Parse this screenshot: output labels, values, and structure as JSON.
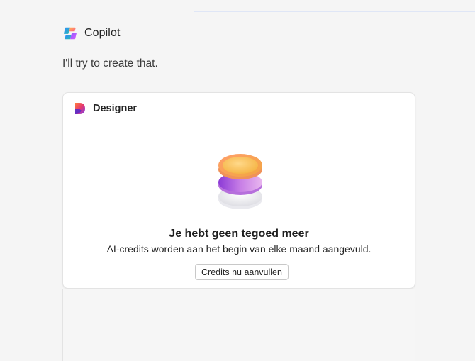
{
  "conversation": {
    "assistant_name": "Copilot",
    "assistant_logo_icon": "copilot-logo-icon",
    "message": "I'll try to create that."
  },
  "designer_card": {
    "app_name": "Designer",
    "app_logo_icon": "designer-logo-icon",
    "illustration_icon": "coin-stack-icon",
    "title": "Je hebt geen tegoed meer",
    "subtitle": "AI-credits worden aan het begin van elke maand aangevuld.",
    "button_label": "Credits nu aanvullen"
  },
  "colors": {
    "page_background": "#f5f5f5",
    "card_background": "#ffffff",
    "card_border": "#e3e3e3",
    "top_divider": "#dfe6f6"
  }
}
